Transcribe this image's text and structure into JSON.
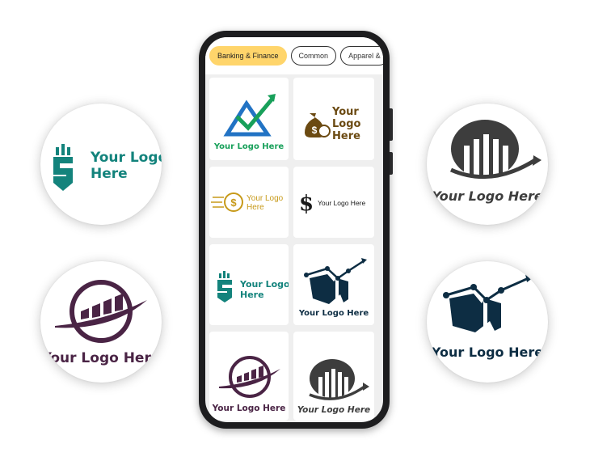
{
  "categories": {
    "tabs": [
      {
        "label": "Banking & Finance",
        "active": true
      },
      {
        "label": "Common",
        "active": false
      },
      {
        "label": "Apparel &",
        "active": false
      }
    ]
  },
  "showcase": {
    "left_top": {
      "line1": "Your Logo",
      "line2": "Here",
      "icon": "shield-s-icon",
      "color": "#13837c"
    },
    "left_bottom": {
      "text": "Your Logo Here",
      "icon": "rising-bars-swoosh-icon",
      "color": "#4a2445"
    },
    "right_top": {
      "text": "Your Logo Here",
      "icon": "bar-chart-arrow-icon",
      "color": "#3d3d3d"
    },
    "right_bottom": {
      "text": "Your Logo Here",
      "icon": "chart-trend-line-icon",
      "color": "#0d2d43"
    }
  },
  "logo_grid": [
    {
      "text": "Your Logo Here",
      "icon": "triangle-check-arrow-icon",
      "color": "#18a05a"
    },
    {
      "line1": "Your",
      "line2": "Logo",
      "line3": "Here",
      "icon": "money-bag-icon",
      "color": "#6b4a12"
    },
    {
      "line1": "Your Logo",
      "line2": "Here",
      "icon": "coin-speed-icon",
      "color": "#c79a1a"
    },
    {
      "text": "Your Logo Here",
      "icon": "dollar-sign-icon",
      "color": "#1a1a1a"
    },
    {
      "line1": "Your Logo",
      "line2": "Here",
      "icon": "shield-s-icon",
      "color": "#13837c"
    },
    {
      "text": "Your Logo Here",
      "icon": "chart-trend-line-icon",
      "color": "#0d2d43"
    },
    {
      "text": "Your Logo Here",
      "icon": "rising-bars-swoosh-icon",
      "color": "#4a2445"
    },
    {
      "text": "Your Logo Here",
      "icon": "bar-chart-arrow-icon",
      "color": "#3d3d3d"
    }
  ]
}
